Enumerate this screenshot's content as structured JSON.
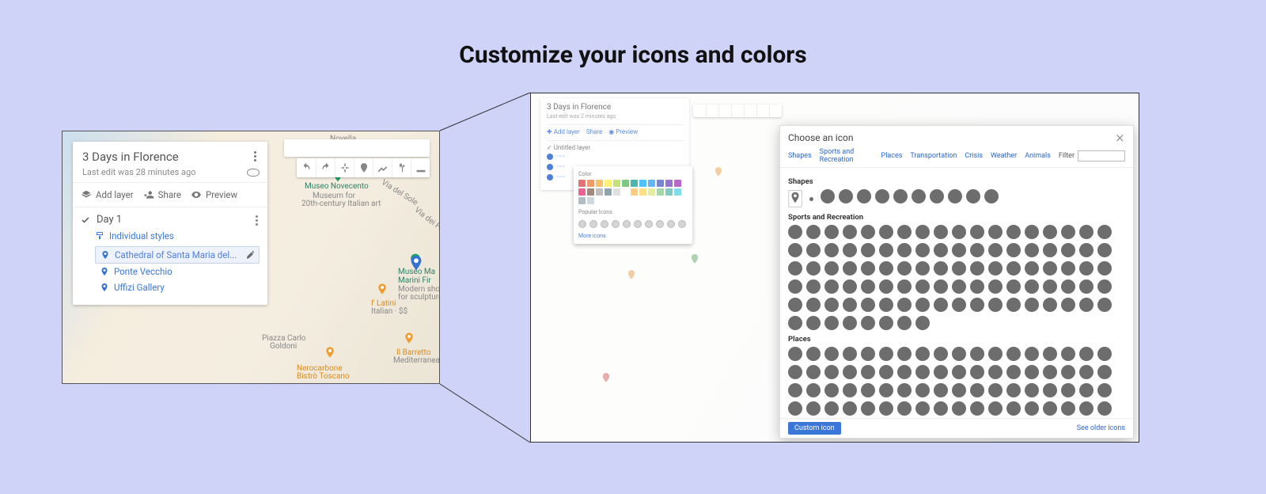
{
  "page_heading": "Customize your icons and colors",
  "left": {
    "map_title": "3 Days in Florence",
    "last_edit": "Last edit was 28 minutes ago",
    "actions": {
      "add_layer": "Add layer",
      "share": "Share",
      "preview": "Preview"
    },
    "layer_name": "Day 1",
    "styles_label": "Individual styles",
    "places": [
      {
        "name": "Cathedral of Santa Maria del...",
        "selected": true
      },
      {
        "name": "Ponte Vecchio",
        "selected": false
      },
      {
        "name": "Uffizi Gallery",
        "selected": false
      }
    ],
    "bg_labels": {
      "novecento": "Museo Novecento",
      "novecento_sub": "Museum for",
      "novecento_sub2": "20th-century Italian art",
      "museo_marini": "Museo Ma",
      "museo_marini2": "Marini Fir",
      "museo_marini3": "Modern sho",
      "museo_marini4": "for sculpture",
      "ilatini": "I' Latini",
      "ilatini2": "Italian · $$",
      "goldoni": "Piazza Carlo",
      "goldoni2": "Goldoni",
      "nero": "Nerocarbone",
      "nero2": "Bistrò Toscano",
      "barretto": "Il Barretto",
      "barretto2": "Mediterranea",
      "fossi": "Via dei Fossi",
      "sole": "Via del Sole",
      "novella": "Novella"
    }
  },
  "right": {
    "map_title": "3 Days in Florence",
    "last_edit": "Last edit was 2 minutes ago",
    "actions": {
      "add_layer": "Add layer",
      "share": "Share",
      "preview": "Preview"
    },
    "layer_name": "Untitled layer",
    "popover": {
      "color_label": "Color",
      "icons_label": "Popular Icons",
      "more_link": "More icons"
    },
    "dialog": {
      "title": "Choose an icon",
      "tabs": [
        "Shapes",
        "Sports and Recreation",
        "Places",
        "Transportation",
        "Crisis",
        "Weather",
        "Animals"
      ],
      "filter_label": "Filter",
      "cat_shapes": "Shapes",
      "cat_sports": "Sports and Recreation",
      "cat_places": "Places",
      "custom_btn": "Custom icon",
      "older_link": "See older icons"
    },
    "swatch_colors": [
      "#e57373",
      "#ef9a6a",
      "#f4c26b",
      "#fff176",
      "#c5e17a",
      "#81c784",
      "#4db6ac",
      "#4fc3f7",
      "#64b5f6",
      "#7986cb",
      "#9575cd",
      "#ba68c8",
      "#f06292",
      "#a1887f",
      "#bdbdbd",
      "#90a4ae",
      "#e0e0e0",
      "#ffffff",
      "#ffcc80",
      "#ffe082",
      "#e6ee9c",
      "#a5d6a7",
      "#80cbc4",
      "#80deea",
      "#b0bec5",
      "#cfd8dc"
    ]
  }
}
